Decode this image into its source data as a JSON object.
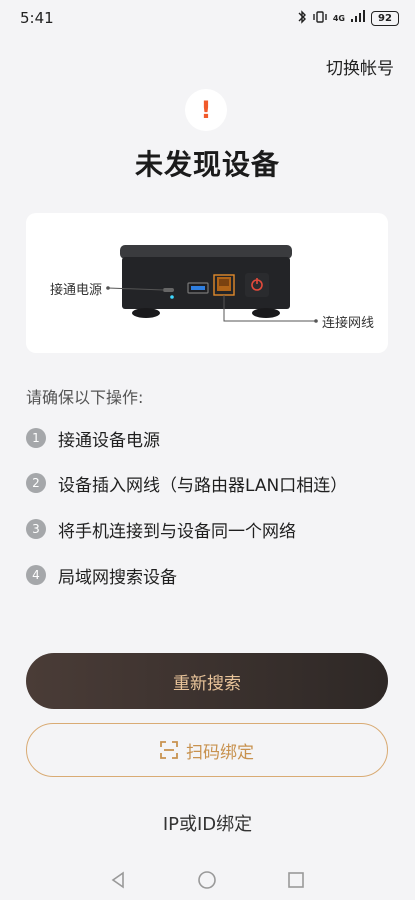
{
  "status": {
    "time": "5:41",
    "network": "4G",
    "battery": "92"
  },
  "header": {
    "switch_account": "切换帐号"
  },
  "alert": {
    "icon": "exclamation-icon",
    "title": "未发现设备",
    "accent": "#f15a2b"
  },
  "device_card": {
    "power_label": "接通电源",
    "network_label": "连接网线"
  },
  "instructions": {
    "heading": "请确保以下操作:",
    "steps": [
      {
        "num": "1",
        "text": "接通设备电源"
      },
      {
        "num": "2",
        "text": "设备插入网线（与路由器LAN口相连）"
      },
      {
        "num": "3",
        "text": "将手机连接到与设备同一个网络"
      },
      {
        "num": "4",
        "text": "局域网搜索设备"
      }
    ]
  },
  "actions": {
    "research": "重新搜索",
    "scan_bind": "扫码绑定",
    "ip_bind": "IP或ID绑定"
  }
}
